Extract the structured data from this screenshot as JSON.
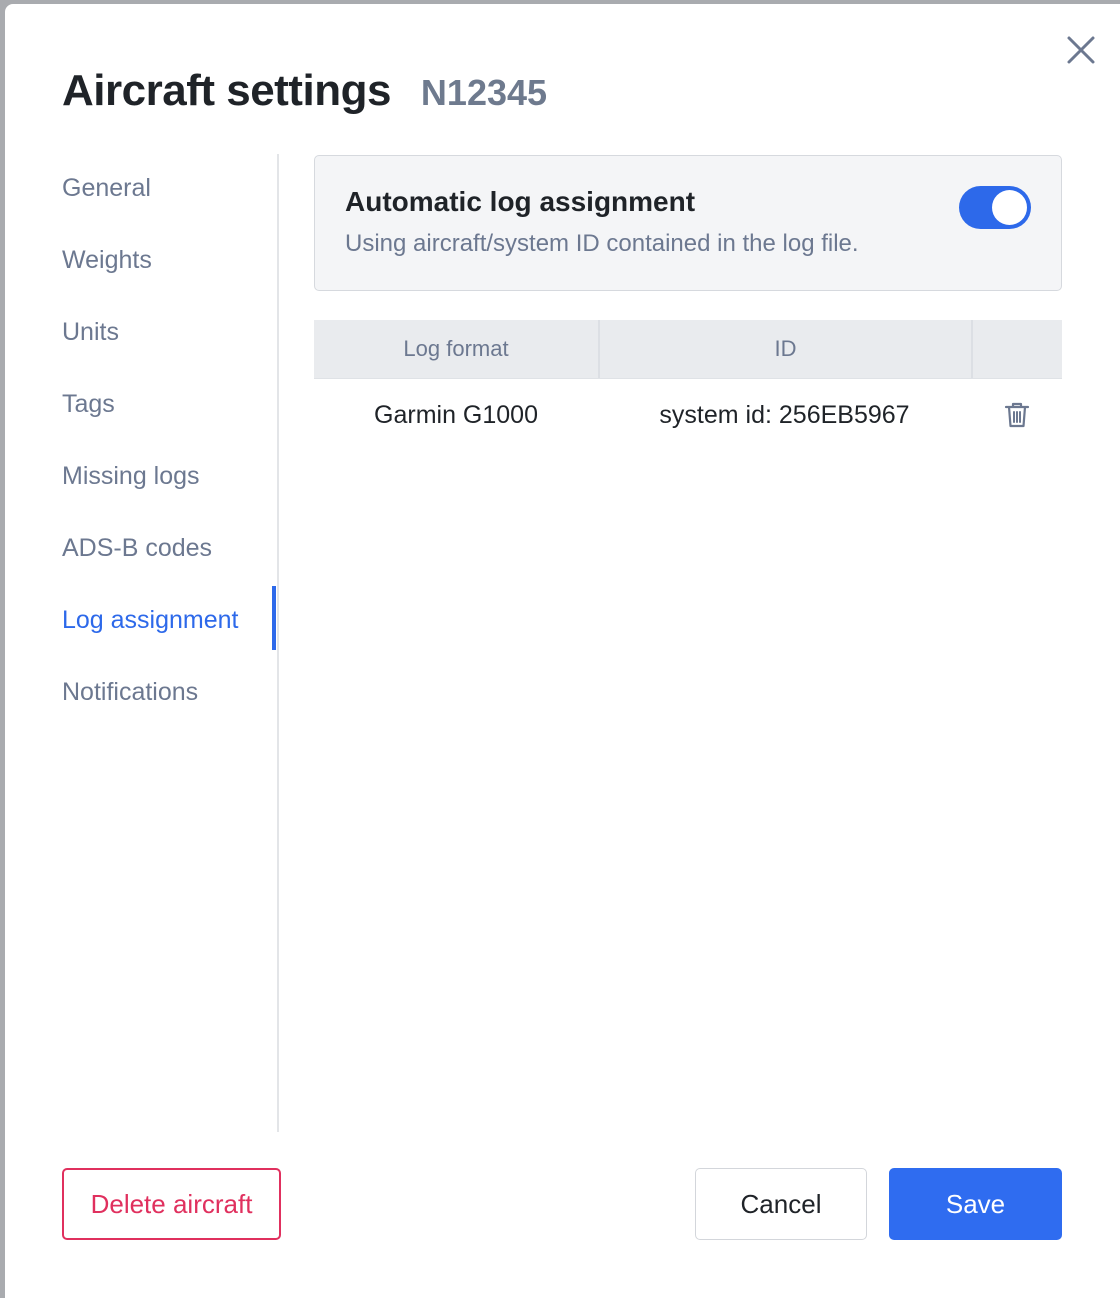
{
  "dialog": {
    "title": "Aircraft settings",
    "tail_number": "N12345",
    "close_icon": "close-icon"
  },
  "sidebar": {
    "items": [
      {
        "label": "General",
        "active": false
      },
      {
        "label": "Weights",
        "active": false
      },
      {
        "label": "Units",
        "active": false
      },
      {
        "label": "Tags",
        "active": false
      },
      {
        "label": "Missing logs",
        "active": false
      },
      {
        "label": "ADS-B codes",
        "active": false
      },
      {
        "label": "Log assignment",
        "active": true
      },
      {
        "label": "Notifications",
        "active": false
      }
    ]
  },
  "auto_assignment": {
    "title": "Automatic log assignment",
    "description": "Using aircraft/system ID contained in the log file.",
    "enabled": true
  },
  "table": {
    "columns": [
      "Log format",
      "ID",
      ""
    ],
    "rows": [
      {
        "log_format": "Garmin G1000",
        "id": "system id: 256EB5967",
        "action_icon": "trash-icon"
      }
    ]
  },
  "footer": {
    "delete_label": "Delete aircraft",
    "cancel_label": "Cancel",
    "save_label": "Save"
  },
  "colors": {
    "accent": "#2d69ea",
    "danger": "#e0305e",
    "muted_text": "#6c7890"
  }
}
